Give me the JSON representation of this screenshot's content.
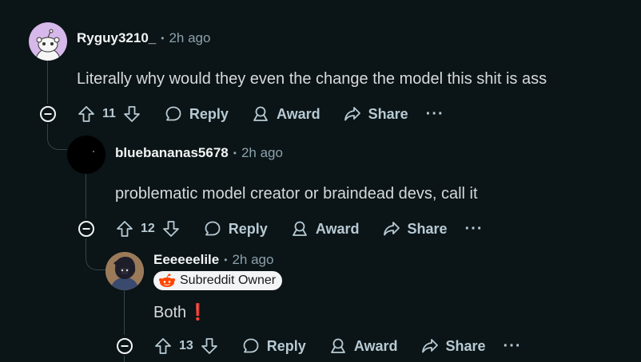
{
  "comments": [
    {
      "username": "Ryguy3210_",
      "time": "2h ago",
      "body": "Literally why would they even the change the model this shit is ass",
      "votes": "11",
      "reply_label": "Reply",
      "award_label": "Award",
      "share_label": "Share",
      "more_label": "···"
    },
    {
      "username": "bluebananas5678",
      "time": "2h ago",
      "body": "problematic model creator or braindead devs, call it",
      "votes": "12",
      "reply_label": "Reply",
      "award_label": "Award",
      "share_label": "Share",
      "more_label": "···"
    },
    {
      "username": "Eeeeeelile",
      "time": "2h ago",
      "flair": "Subreddit Owner",
      "body": "Both",
      "body_emoji": "❗",
      "votes": "13",
      "reply_label": "Reply",
      "award_label": "Award",
      "share_label": "Share",
      "more_label": "···"
    }
  ],
  "separator": "•",
  "colors": {
    "background": "#0b1416",
    "username": "#f2f4f5",
    "meta": "#8ba2ad",
    "thread_line": "#33464c",
    "flair_bg": "#f2f4f5",
    "reddit_orange": "#ff4500",
    "exclamation": "#e5173f"
  },
  "icons": [
    "avatar-snoo",
    "upvote-icon",
    "downvote-icon",
    "reply-bubble-icon",
    "award-icon",
    "share-icon",
    "collapse-icon",
    "snoo-icon"
  ]
}
